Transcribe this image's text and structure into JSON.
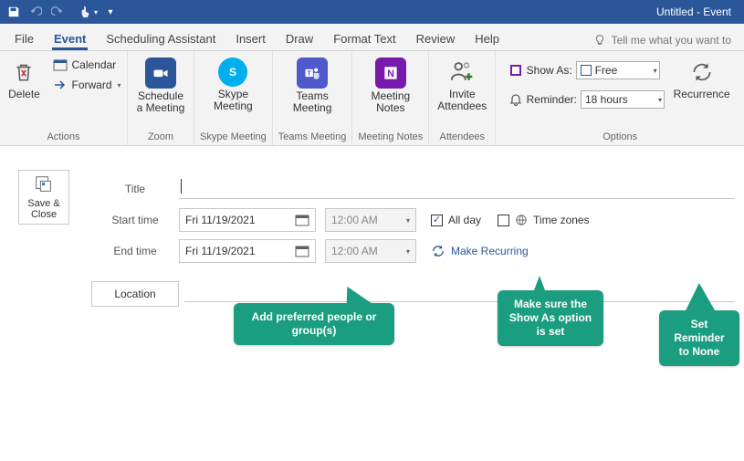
{
  "titlebar": {
    "title": "Untitled  -  Event"
  },
  "tabs": {
    "file": "File",
    "event": "Event",
    "scheduling": "Scheduling Assistant",
    "insert": "Insert",
    "draw": "Draw",
    "format_text": "Format Text",
    "review": "Review",
    "help": "Help",
    "tellme": "Tell me what you want to"
  },
  "ribbon": {
    "actions": {
      "delete": "Delete",
      "calendar": "Calendar",
      "forward": "Forward",
      "group": "Actions"
    },
    "zoom": {
      "label1": "Schedule",
      "label2": "a Meeting",
      "group": "Zoom"
    },
    "skype": {
      "label1": "Skype",
      "label2": "Meeting",
      "group": "Skype Meeting"
    },
    "teams": {
      "label1": "Teams",
      "label2": "Meeting",
      "group": "Teams Meeting"
    },
    "notes": {
      "label1": "Meeting",
      "label2": "Notes",
      "group": "Meeting Notes"
    },
    "invite": {
      "label1": "Invite",
      "label2": "Attendees",
      "group": "Attendees"
    },
    "options": {
      "show_as_label": "Show As:",
      "show_as_value": "Free",
      "reminder_label": "Reminder:",
      "reminder_value": "18 hours",
      "recurrence": "Recurrence",
      "group": "Options"
    }
  },
  "form": {
    "save_close": "Save & Close",
    "title_label": "Title",
    "title_value": "",
    "start_label": "Start time",
    "start_date": "Fri 11/19/2021",
    "start_time": "12:00 AM",
    "end_label": "End time",
    "end_date": "Fri 11/19/2021",
    "end_time": "12:00 AM",
    "all_day": "All day",
    "time_zones": "Time zones",
    "make_recurring": "Make Recurring",
    "location_btn": "Location"
  },
  "callouts": {
    "c1": "Add preferred people or group(s)",
    "c2": "Make sure the Show As option is set",
    "c3": "Set Reminder to None"
  }
}
